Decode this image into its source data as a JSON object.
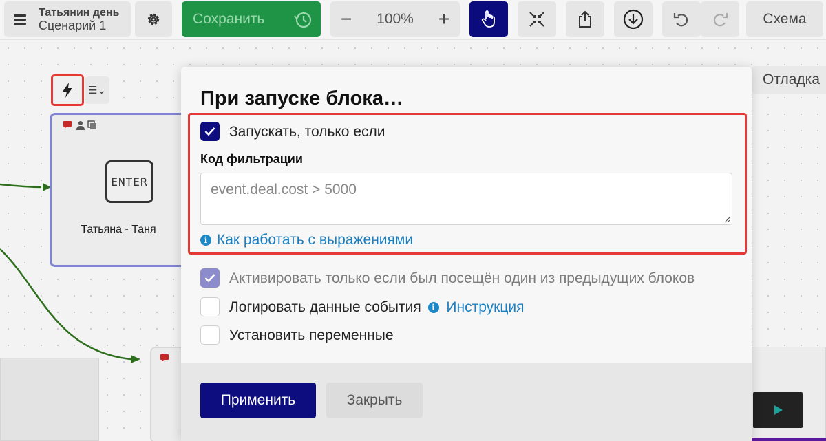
{
  "toolbar": {
    "project_title": "Татьянин день",
    "scenario_title": "Сценарий 1",
    "save_label": "Сохранить",
    "zoom_minus": "−",
    "zoom_level": "100%",
    "zoom_plus": "+",
    "schema_label": "Схема",
    "icons": [
      "menu-icon",
      "gear-icon",
      "history-icon",
      "hand-pointer-icon",
      "collapse-icon",
      "share-icon",
      "download-icon",
      "undo-icon",
      "redo-icon"
    ],
    "colors": {
      "save": "#1f9447",
      "active_tool": "#0b0b7d"
    }
  },
  "canvas": {
    "debug_label": "Отладка",
    "node_label": "Татьяна - Таня",
    "node_key_text": "ENTER",
    "list_button_label": "☰⌄"
  },
  "modal": {
    "title": "При запуске блока…",
    "run_only_if": {
      "label": "Запускать, только если",
      "checked": true
    },
    "filter_code_label": "Код фильтрации",
    "filter_code_value": "event.deal.cost > 5000",
    "help_link": "Как работать с выражениями",
    "activate_only_if_visited": {
      "label": "Активировать только если был посещён один из предыдущих блоков",
      "checked": true,
      "disabled": true
    },
    "log_event_data": {
      "label": "Логировать данные события",
      "checked": false,
      "link": "Инструкция"
    },
    "set_variables": {
      "label": "Установить переменные",
      "checked": false
    },
    "apply_label": "Применить",
    "close_label": "Закрыть",
    "colors": {
      "primary": "#0d0d80",
      "link": "#1a7fc1",
      "highlight_border": "#e53935"
    }
  }
}
